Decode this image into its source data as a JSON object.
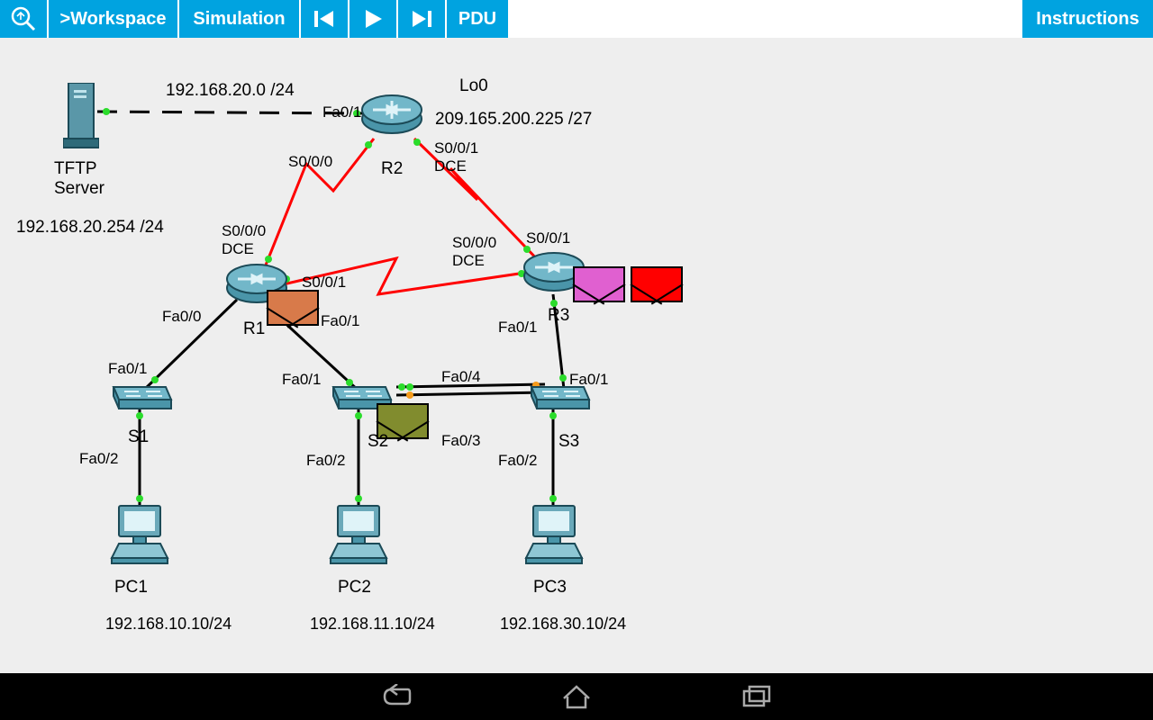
{
  "toolbar": {
    "workspace": ">Workspace",
    "simulation": "Simulation",
    "pdu": "PDU",
    "instructions": "Instructions"
  },
  "devices": {
    "tftp": {
      "name": "TFTP\nServer",
      "ip": "192.168.20.254 /24"
    },
    "r1": {
      "name": "R1"
    },
    "r2": {
      "name": "R2",
      "lo_name": "Lo0",
      "lo_ip": "209.165.200.225 /27"
    },
    "r3": {
      "name": "R3"
    },
    "s1": {
      "name": "S1"
    },
    "s2": {
      "name": "S2"
    },
    "s3": {
      "name": "S3"
    },
    "pc1": {
      "name": "PC1",
      "ip": "192.168.10.10/24"
    },
    "pc2": {
      "name": "PC2",
      "ip": "192.168.11.10/24"
    },
    "pc3": {
      "name": "PC3",
      "ip": "192.168.30.10/24"
    }
  },
  "subnets": {
    "tftp_r2": "192.168.20.0 /24"
  },
  "if": {
    "r2_fa01": "Fa0/1",
    "r2_s000": "S0/0/0",
    "r2_s001": "S0/0/1\nDCE",
    "r1_s000": "S0/0/0\nDCE",
    "r1_s001": "S0/0/1",
    "r1_fa00": "Fa0/0",
    "r1_fa01": "Fa0/1",
    "r3_s000": "S0/0/0\nDCE",
    "r3_s001": "S0/0/1",
    "r3_fa01": "Fa0/1",
    "s1_fa01": "Fa0/1",
    "s1_fa02": "Fa0/2",
    "s2_fa01": "Fa0/1",
    "s2_fa02": "Fa0/2",
    "s2_fa03": "Fa0/3",
    "s2_fa04": "Fa0/4",
    "s3_fa01": "Fa0/1",
    "s3_fa02": "Fa0/2"
  },
  "pdu_colors": {
    "r1": "#d87a4a",
    "r3a": "#e060d0",
    "r3b": "#ff0000",
    "s2": "#818c2e"
  }
}
